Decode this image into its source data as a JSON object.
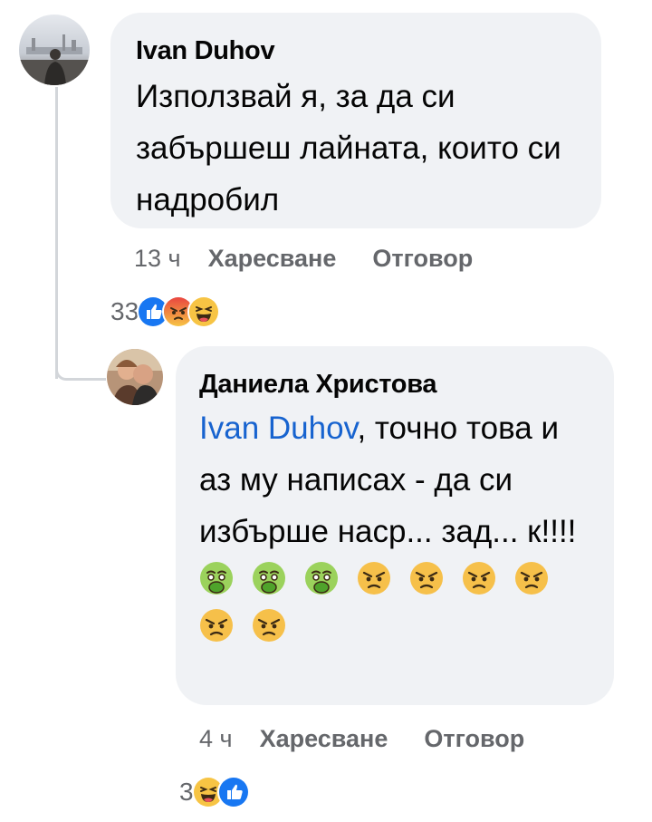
{
  "comments": [
    {
      "author": "Ivan Duhov",
      "text": "Използвай я, за да си забършеш лайната, които си надробил",
      "time": "13 ч",
      "like_label": "Харесване",
      "reply_label": "Отговор",
      "reaction_count": "33",
      "reactions": [
        "like-icon",
        "angry-icon",
        "haha-icon"
      ]
    },
    {
      "author": "Даниела Христова",
      "mention": "Ivan Duhov",
      "text_after_mention": ", точно това и аз му написах - да си избърше наср... зад... к!!!!",
      "emojis": [
        "nauseated-face-icon",
        "nauseated-face-icon",
        "nauseated-face-icon",
        "angry-face-icon",
        "angry-face-icon",
        "angry-face-icon",
        "angry-face-icon",
        "angry-face-icon",
        "angry-face-icon"
      ],
      "time": "4 ч",
      "like_label": "Харесване",
      "reply_label": "Отговор",
      "reaction_count": "3",
      "reactions": [
        "haha-icon",
        "like-icon"
      ]
    }
  ],
  "colors": {
    "bubble": "#f0f2f5",
    "mention": "#1763cf",
    "meta": "#65676b",
    "like": "#1877f2",
    "thread_line": "#d3d6da"
  }
}
